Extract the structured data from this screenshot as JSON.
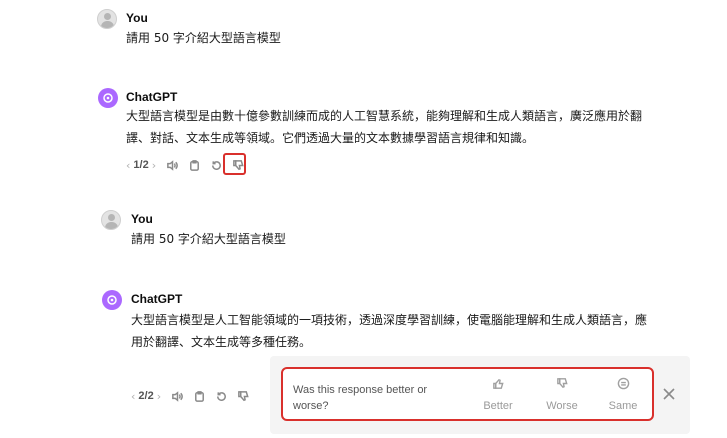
{
  "messages": [
    {
      "author": "You",
      "text": "請用 50 字介紹大型語言模型"
    },
    {
      "author": "ChatGPT",
      "lines": [
        "大型語言模型是由數十億參數訓練而成的人工智慧系統，能夠理解和生成人類語言，廣泛應用於翻",
        "譯、對話、文本生成等領域。它們透過大量的文本數據學習語言規律和知識。"
      ],
      "pager": "1/2"
    },
    {
      "author": "You",
      "text": "請用 50 字介紹大型語言模型"
    },
    {
      "author": "ChatGPT",
      "lines": [
        "大型語言模型是人工智能領域的一項技術，透過深度學習訓練，使電腦能理解和生成人類語言，應",
        "用於翻譯、文本生成等多種任務。"
      ],
      "pager": "2/2"
    }
  ],
  "pager_prev": "‹",
  "pager_next": "›",
  "feedback": {
    "question": "Was this response better or worse?",
    "options": [
      "Better",
      "Worse",
      "Same"
    ]
  },
  "icons": [
    "user-avatar-icon",
    "chatgpt-logo-icon",
    "speaker-icon",
    "copy-icon",
    "regenerate-icon",
    "thumbs-down-icon",
    "thumbs-up-icon",
    "equal-icon",
    "close-icon"
  ],
  "colors": {
    "highlight": "#d9302c",
    "chatgpt_avatar": "#ab68ff"
  }
}
